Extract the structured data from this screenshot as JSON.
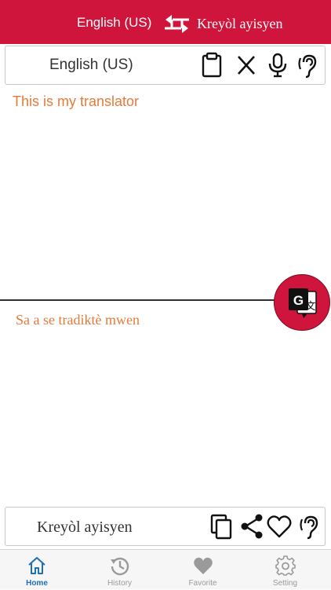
{
  "header": {
    "source_language": "English (US)",
    "target_language": "Kreyòl ayisyen",
    "swap_icon": "swap-arrows-icon",
    "background_color": "#d0153c"
  },
  "input": {
    "language_label": "English (US)",
    "text": "This is my translator",
    "tools": [
      "clipboard-icon",
      "clear-x-icon",
      "microphone-icon",
      "listen-ear-icon"
    ]
  },
  "translate_button": {
    "icon": "google-translate-icon",
    "color": "#d0153c"
  },
  "output": {
    "text": "Sa a se tradiktè mwen",
    "language_label": "Kreyòl ayisyen",
    "tools": [
      "copy-icon",
      "share-icon",
      "heart-icon",
      "listen-ear-icon"
    ]
  },
  "tabbar": {
    "tabs": [
      {
        "label": "Home",
        "icon": "home-icon",
        "active": true
      },
      {
        "label": "History",
        "icon": "history-icon",
        "active": false
      },
      {
        "label": "Favorite",
        "icon": "heart-icon",
        "active": false
      },
      {
        "label": "Setting",
        "icon": "gear-icon",
        "active": false
      }
    ],
    "active_color": "#1d6fb8",
    "inactive_color": "#9a9a9a"
  },
  "colors": {
    "accent": "#d0153c",
    "text_orange": "#e67a3a"
  }
}
